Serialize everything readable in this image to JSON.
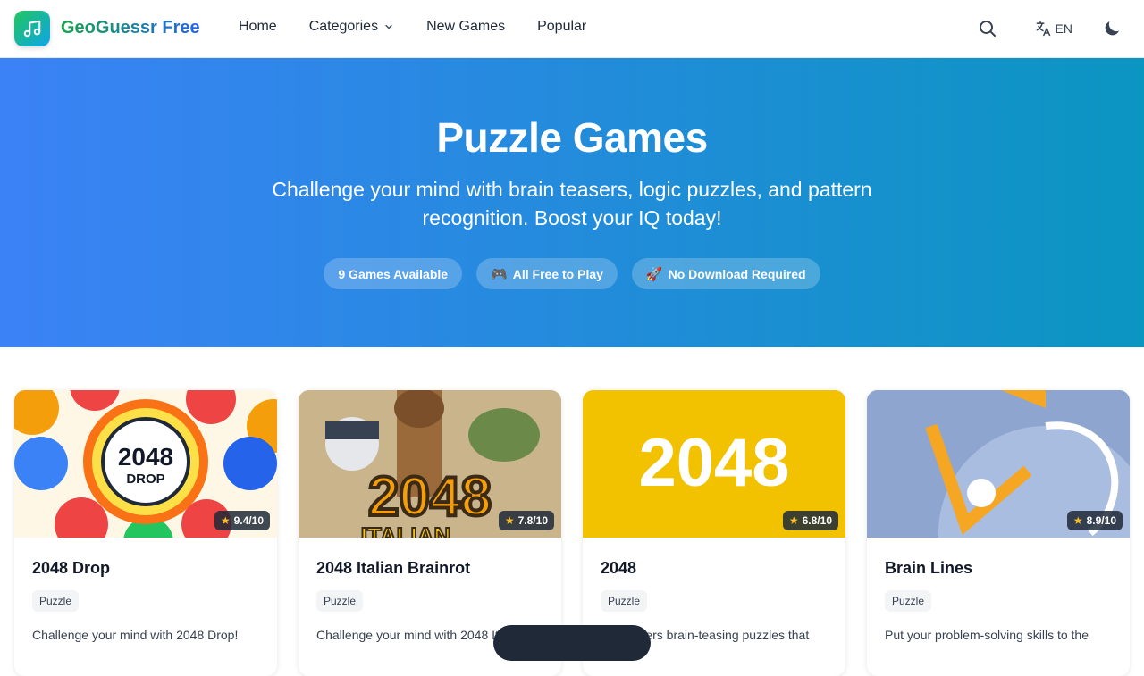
{
  "header": {
    "brand": "GeoGuessr Free",
    "nav": [
      "Home",
      "Categories",
      "New Games",
      "Popular"
    ],
    "lang": "EN",
    "icons": {
      "logo": "music-note-icon",
      "search": "search-icon",
      "language": "translate-icon",
      "theme": "moon-icon",
      "dropdown": "chevron-down-icon"
    }
  },
  "hero": {
    "title": "Puzzle Games",
    "subtitle": "Challenge your mind with brain teasers, logic puzzles, and pattern recognition. Boost your IQ today!",
    "pills": [
      {
        "emoji": "",
        "label": "9 Games Available"
      },
      {
        "emoji": "🎮",
        "label": "All Free to Play"
      },
      {
        "emoji": "🚀",
        "label": "No Download Required"
      }
    ]
  },
  "cards": [
    {
      "title": "2048 Drop",
      "category": "Puzzle",
      "rating": "9.4/10",
      "description": "Challenge your mind with 2048 Drop!",
      "thumb_text": "2048\nDROP"
    },
    {
      "title": "2048 Italian Brainrot",
      "category": "Puzzle",
      "rating": "7.8/10",
      "description": "Challenge your mind with 2048 Italian",
      "thumb_text": "2048"
    },
    {
      "title": "2048",
      "category": "Puzzle",
      "rating": "6.8/10",
      "description": "2048 offers brain-teasing puzzles that",
      "thumb_text": "2048"
    },
    {
      "title": "Brain Lines",
      "category": "Puzzle",
      "rating": "8.9/10",
      "description": "Put your problem-solving skills to the",
      "thumb_text": ""
    }
  ],
  "colors": {
    "hero_start": "#3b82f6",
    "hero_end": "#0b95c1",
    "brand_green": "#16a34a",
    "thumb_yellow": "#f2c200"
  }
}
